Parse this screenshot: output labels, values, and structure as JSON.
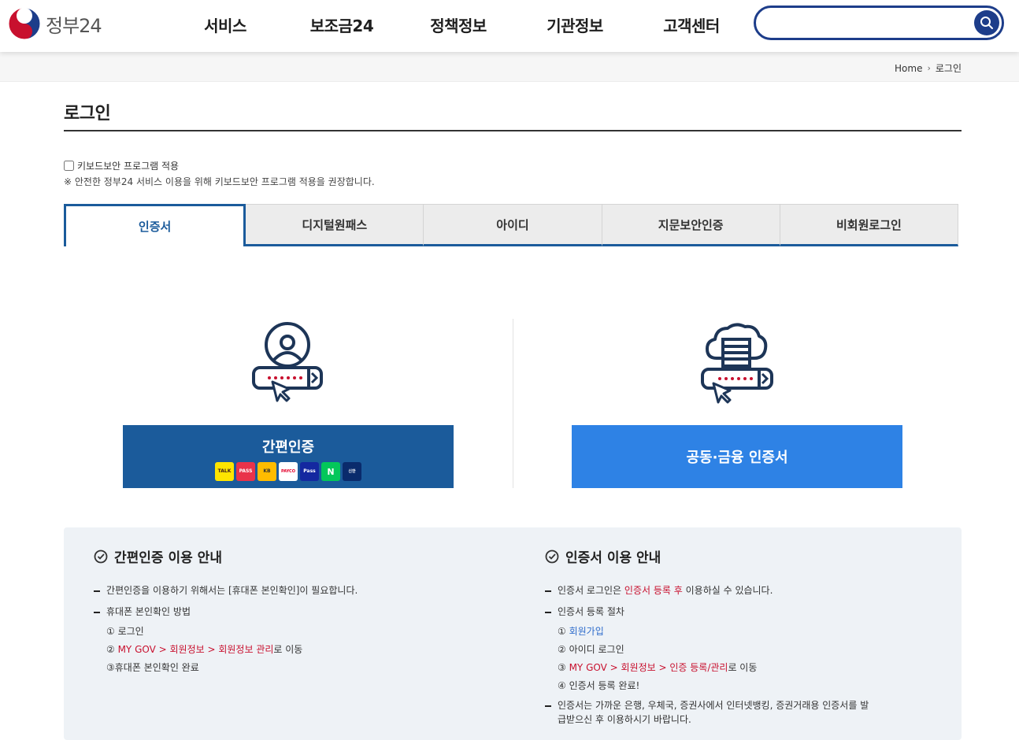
{
  "header": {
    "logo_text": "정부24",
    "nav": [
      "서비스",
      "보조금24",
      "정책정보",
      "기관정보",
      "고객센터"
    ],
    "search_placeholder": "",
    "colors": {
      "brand_navy": "#1d3d8a"
    }
  },
  "breadcrumb": {
    "home": "Home",
    "current": "로그인"
  },
  "page": {
    "title": "로그인",
    "keyboard_security_label": "키보드보안 프로그램 적용",
    "keyboard_security_checked": false,
    "keyboard_note": "※ 안전한 정부24 서비스 이용을 위해 키보드보안 프로그램 적용을 권장합니다."
  },
  "tabs": [
    {
      "label": "인증서",
      "active": true
    },
    {
      "label": "디지털원패스",
      "active": false
    },
    {
      "label": "아이디",
      "active": false
    },
    {
      "label": "지문보안인증",
      "active": false
    },
    {
      "label": "비회원로그인",
      "active": false
    }
  ],
  "login_options": {
    "simple_auth_label": "간편인증",
    "simple_auth_providers": [
      "TALK",
      "PASS",
      "KB",
      "PAYCO",
      "Pass",
      "N",
      "신한"
    ],
    "cert_label": "공동·금융 인증서",
    "colors": {
      "simple": "#1b5b9b",
      "cert": "#2e82e5"
    }
  },
  "guide_left": {
    "title": "간편인증 이용 안내",
    "item1": "간편인증을 이용하기 위해서는 [휴대폰 본인확인]이 필요합니다.",
    "item2": "휴대폰 본인확인 방법",
    "step1": "① 로그인",
    "step2_prefix": "② ",
    "step2_link": "MY GOV > 회원정보 > 회원정보 관리",
    "step2_suffix": "로 이동",
    "step3": "③휴대폰 본인확인 완료"
  },
  "guide_right": {
    "title": "인증서 이용 안내",
    "item1_prefix": "인증서 로그인은 ",
    "item1_link": "인증서 등록 후",
    "item1_suffix": " 이용하실 수 있습니다.",
    "item2": "인증서 등록 절차",
    "step1_prefix": "① ",
    "step1_link": "회원가입",
    "step2": "② 아이디 로그인",
    "step3_prefix": "③ ",
    "step3_link": "MY GOV > 회원정보 > 인증 등록/관리",
    "step3_suffix": "로 이동",
    "step4": "④ 인증서 등록 완료!",
    "item3": "인증서는 가까운 은행, 우체국, 증권사에서 인터넷뱅킹, 증권거래용 인증서를 발급받으신 후 이용하시기 바랍니다."
  }
}
